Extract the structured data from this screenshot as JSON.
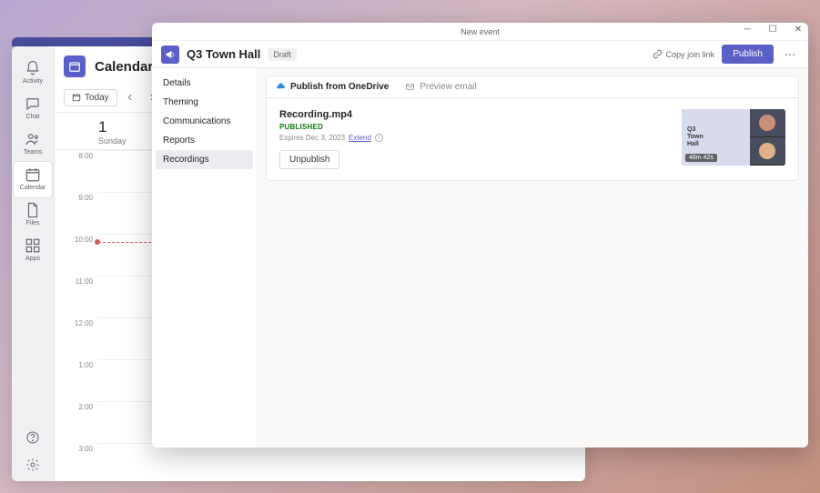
{
  "teams": {
    "rail": {
      "activity": "Activity",
      "chat": "Chat",
      "teams": "Teams",
      "calendar": "Calendar",
      "files": "Files",
      "apps": "Apps"
    },
    "calendar": {
      "title": "Calendar",
      "today_label": "Today",
      "day_number": "1",
      "day_name": "Sunday",
      "times": [
        "8:00",
        "9:00",
        "10:00",
        "11:00",
        "12:00",
        "1:00",
        "2:00",
        "3:00"
      ]
    }
  },
  "modal": {
    "window_title": "New event",
    "event_name": "Q3 Town Hall",
    "draft_label": "Draft",
    "copy_join_link": "Copy join link",
    "publish_button": "Publish",
    "sidebar": {
      "details": "Details",
      "theming": "Theming",
      "communications": "Communications",
      "reports": "Reports",
      "recordings": "Recordings"
    },
    "tabs": {
      "publish_onedrive": "Publish from OneDrive",
      "preview_email": "Preview email"
    },
    "recording": {
      "filename": "Recording.mp4",
      "status": "PUBLISHED",
      "expiry_prefix": "Expires Dec 3, 2023",
      "extend": "Extend",
      "unpublish": "Unpublish",
      "thumb_title_l1": "Q3",
      "thumb_title_l2": "Town",
      "thumb_title_l3": "Hall",
      "duration": "48m 42s"
    }
  }
}
